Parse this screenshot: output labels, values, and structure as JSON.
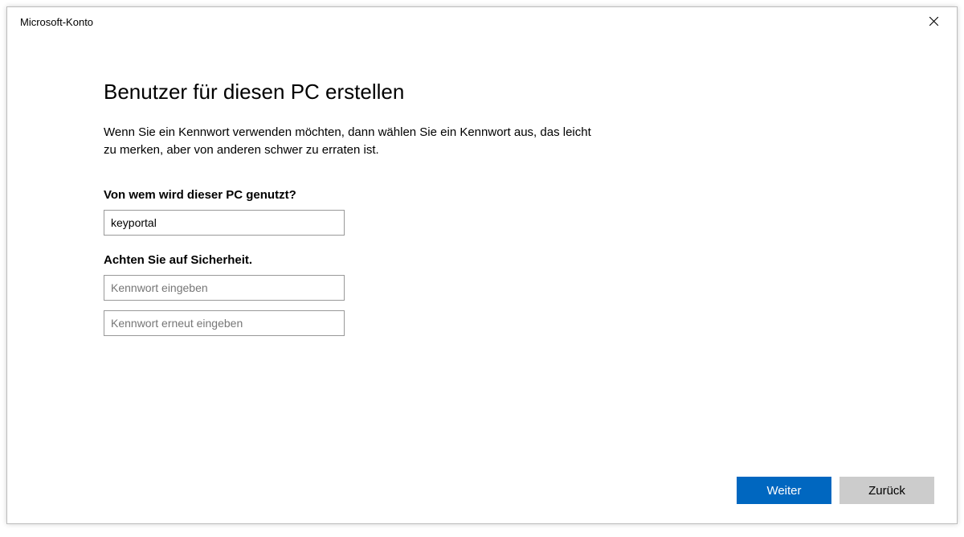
{
  "titlebar": {
    "title": "Microsoft-Konto"
  },
  "page": {
    "heading": "Benutzer für diesen PC erstellen",
    "description": "Wenn Sie ein Kennwort verwenden möchten, dann wählen Sie ein Kennwort aus, das leicht zu merken, aber von anderen schwer zu erraten ist."
  },
  "fields": {
    "user_label": "Von wem wird dieser PC genutzt?",
    "user_value": "keyportal",
    "security_label": "Achten Sie auf Sicherheit.",
    "password_placeholder": "Kennwort eingeben",
    "password_confirm_placeholder": "Kennwort erneut eingeben"
  },
  "buttons": {
    "next": "Weiter",
    "back": "Zurück"
  }
}
